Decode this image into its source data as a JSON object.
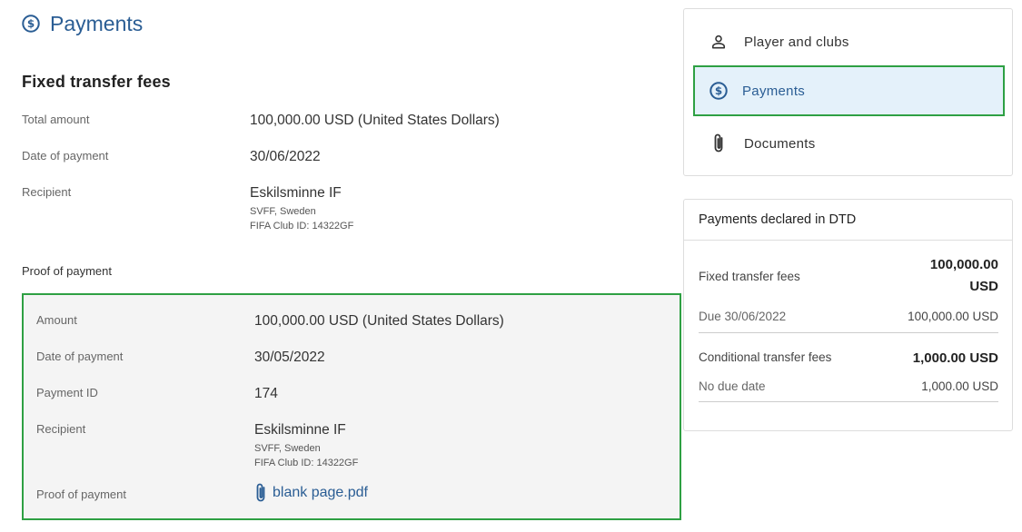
{
  "page": {
    "title": "Payments",
    "accent": "#2a5d94",
    "highlight": "#2ea043"
  },
  "fixed_fees": {
    "heading": "Fixed transfer fees",
    "total_amount": {
      "label": "Total amount",
      "value": "100,000.00 USD (United States Dollars)"
    },
    "date_of_payment": {
      "label": "Date of payment",
      "value": "30/06/2022"
    },
    "recipient": {
      "label": "Recipient",
      "name": "Eskilsminne IF",
      "association": "SVFF, Sweden",
      "club_id": "FIFA Club ID: 14322GF"
    }
  },
  "proof": {
    "section_label": "Proof of payment",
    "amount": {
      "label": "Amount",
      "value": "100,000.00 USD (United States Dollars)"
    },
    "date_of_payment": {
      "label": "Date of payment",
      "value": "30/05/2022"
    },
    "payment_id": {
      "label": "Payment ID",
      "value": "174"
    },
    "recipient": {
      "label": "Recipient",
      "name": "Eskilsminne IF",
      "association": "SVFF, Sweden",
      "club_id": "FIFA Club ID: 14322GF"
    },
    "file": {
      "label": "Proof of payment",
      "name": "blank page.pdf",
      "icon": "paperclip-icon"
    }
  },
  "nav": {
    "items": [
      {
        "label": "Player and clubs",
        "icon": "person-icon"
      },
      {
        "label": "Payments",
        "icon": "dollar-circle-icon",
        "active": true
      },
      {
        "label": "Documents",
        "icon": "paperclip-icon"
      }
    ]
  },
  "declared": {
    "title": "Payments declared in DTD",
    "fixed": {
      "label": "Fixed transfer fees",
      "value_line1": "100,000.00",
      "value_line2": "USD",
      "due_label": "Due 30/06/2022",
      "due_value": "100,000.00 USD"
    },
    "conditional": {
      "label": "Conditional transfer fees",
      "value": "1,000.00 USD",
      "due_label": "No due date",
      "due_value": "1,000.00 USD"
    }
  }
}
